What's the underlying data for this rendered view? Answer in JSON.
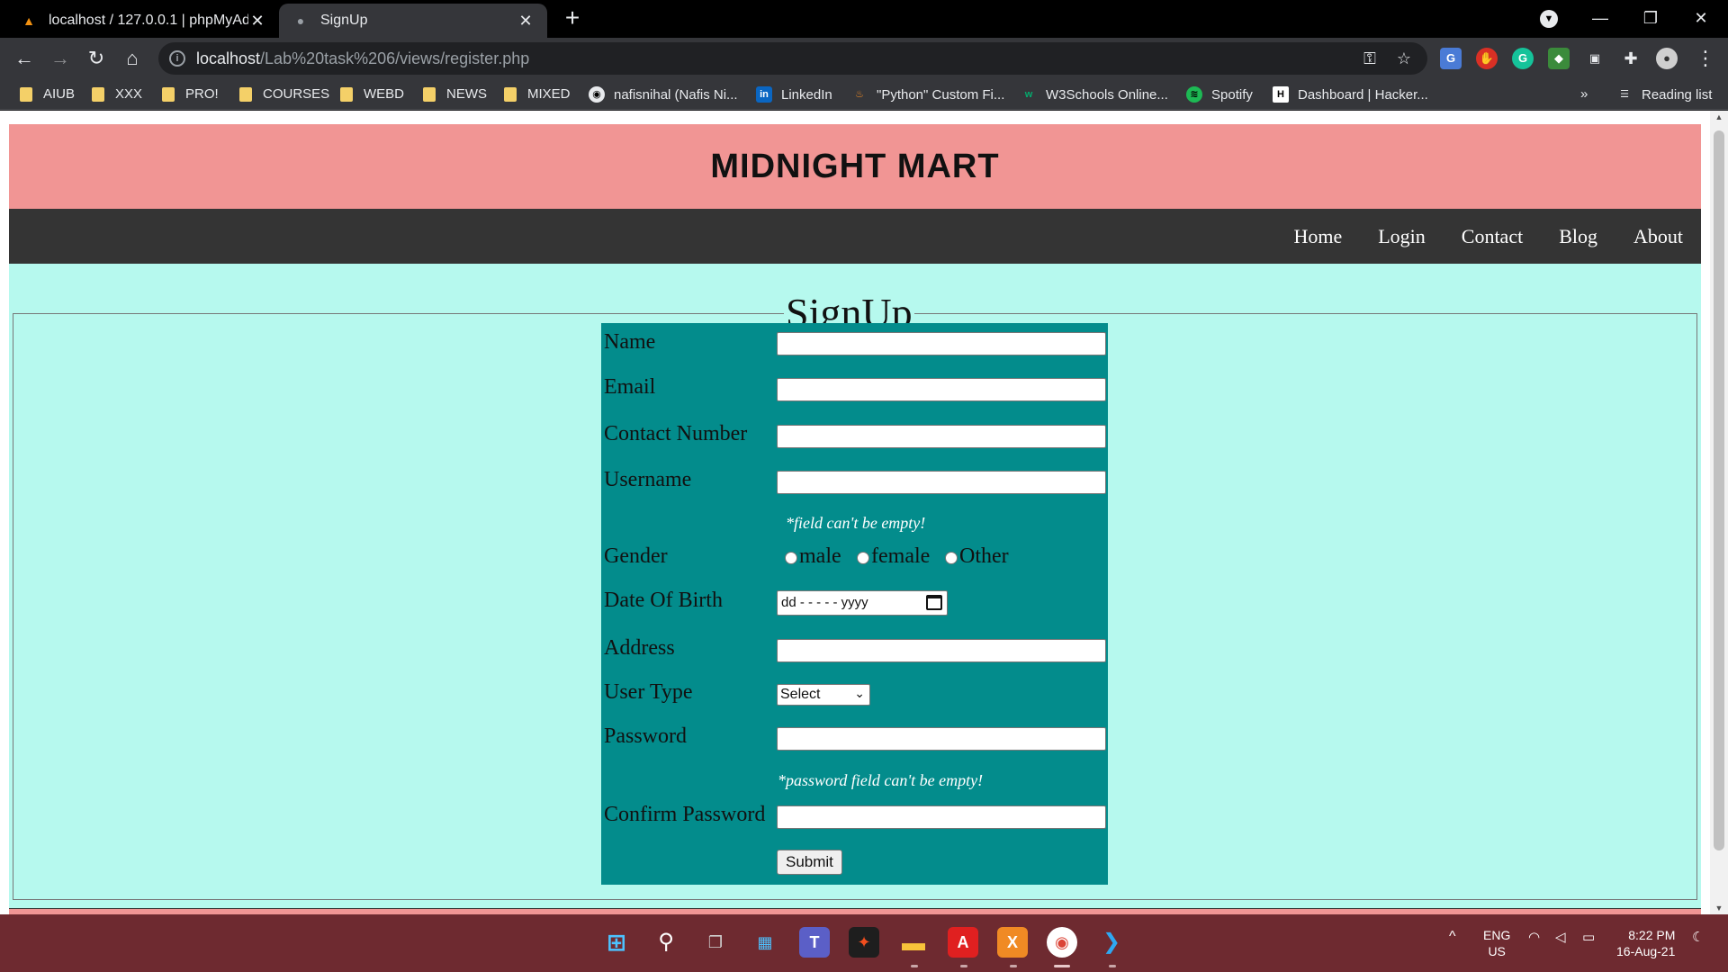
{
  "browser": {
    "tabs": [
      {
        "title": "localhost / 127.0.0.1 | phpMyAdm",
        "icon": "phpmyadmin-icon",
        "active": false
      },
      {
        "title": "SignUp",
        "icon": "globe-icon",
        "active": true
      }
    ],
    "address": {
      "host": "localhost",
      "path": "/Lab%20task%206/views/register.php"
    },
    "bookmarks": [
      {
        "label": "AIUB",
        "icon": "folder-icon"
      },
      {
        "label": "XXX",
        "icon": "folder-icon"
      },
      {
        "label": "PRO!",
        "icon": "folder-icon"
      },
      {
        "label": "COURSES",
        "icon": "folder-icon"
      },
      {
        "label": "WEBD",
        "icon": "folder-icon"
      },
      {
        "label": "NEWS",
        "icon": "folder-icon"
      },
      {
        "label": "MIXED",
        "icon": "folder-icon"
      },
      {
        "label": "nafisnihal (Nafis Ni...",
        "icon": "github-icon"
      },
      {
        "label": "LinkedIn",
        "icon": "linkedin-icon"
      },
      {
        "label": "\"Python\" Custom Fi...",
        "icon": "python-icon"
      },
      {
        "label": "W3Schools Online...",
        "icon": "w3schools-icon"
      },
      {
        "label": "Spotify",
        "icon": "spotify-icon"
      },
      {
        "label": "Dashboard | Hacker...",
        "icon": "hackerrank-icon"
      }
    ],
    "overflow_label": "»",
    "reading_list": "Reading list"
  },
  "site": {
    "title": "MIDNIGHT MART",
    "nav": [
      "Home",
      "Login",
      "Contact",
      "Blog",
      "About"
    ]
  },
  "form": {
    "legend": "SignUp",
    "labels": {
      "name": "Name",
      "email": "Email",
      "contact": "Contact Number",
      "username": "Username",
      "gender": "Gender",
      "dob": "Date Of Birth",
      "address": "Address",
      "user_type": "User Type",
      "password": "Password",
      "confirm_password": "Confirm Password"
    },
    "username_error": "*field can't be empty!",
    "password_error": "*password field can't be empty!",
    "gender_options": [
      "male",
      "female",
      "Other"
    ],
    "dob_placeholder": "dd - - - - - yyyy",
    "user_type_selected": "Select",
    "submit": "Submit"
  },
  "taskbar": {
    "apps": [
      "windows-start-icon",
      "search-icon",
      "task-view-icon",
      "widgets-icon",
      "teams-icon",
      "figma-icon",
      "file-explorer-icon",
      "acrobat-icon",
      "xampp-icon",
      "chrome-icon",
      "vscode-icon"
    ],
    "language": "ENG",
    "region": "US",
    "time": "8:22 PM",
    "date": "16-Aug-21"
  }
}
